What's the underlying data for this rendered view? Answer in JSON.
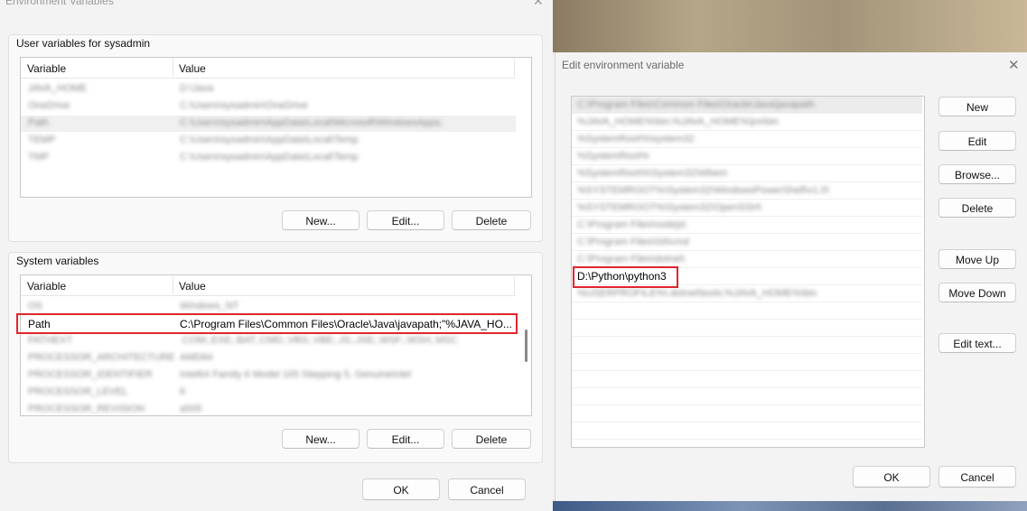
{
  "env_window": {
    "title": "Environment Variables",
    "close_glyph": "✕",
    "user_group": {
      "label": "User variables for sysadmin",
      "columns": [
        "Variable",
        "Value"
      ],
      "rows": [
        {
          "variable": "JAVA_HOME",
          "value": "D:\\Java"
        },
        {
          "variable": "OneDrive",
          "value": "C:\\Users\\sysadmin\\OneDrive"
        },
        {
          "variable": "Path",
          "value": "C:\\Users\\sysadmin\\AppData\\Local\\Microsoft\\WindowsApps;"
        },
        {
          "variable": "TEMP",
          "value": "C:\\Users\\sysadmin\\AppData\\Local\\Temp"
        },
        {
          "variable": "TMP",
          "value": "C:\\Users\\sysadmin\\AppData\\Local\\Temp"
        }
      ],
      "buttons": {
        "new": "New...",
        "edit": "Edit...",
        "delete": "Delete"
      }
    },
    "system_group": {
      "label": "System variables",
      "columns": [
        "Variable",
        "Value"
      ],
      "rows": [
        {
          "variable": "OS",
          "value": "Windows_NT"
        },
        {
          "variable": "Path",
          "value": "C:\\Program Files\\Common Files\\Oracle\\Java\\javapath;\"%JAVA_HO..."
        },
        {
          "variable": "PATHEXT",
          "value": ".COM;.EXE;.BAT;.CMD;.VBS;.VBE;.JS;.JSE;.WSF;.WSH;.MSC"
        },
        {
          "variable": "PROCESSOR_ARCHITECTURE",
          "value": "AMD64"
        },
        {
          "variable": "PROCESSOR_IDENTIFIER",
          "value": "Intel64 Family 6 Model 165 Stepping 5, GenuineIntel"
        },
        {
          "variable": "PROCESSOR_LEVEL",
          "value": "6"
        },
        {
          "variable": "PROCESSOR_REVISION",
          "value": "a505"
        }
      ],
      "buttons": {
        "new": "New...",
        "edit": "Edit...",
        "delete": "Delete"
      }
    },
    "ok": "OK",
    "cancel": "Cancel"
  },
  "edit_window": {
    "title": "Edit environment variable",
    "close_glyph": "✕",
    "path_items": [
      "C:\\Program Files\\Common Files\\Oracle\\Java\\javapath",
      "%JAVA_HOME%\\bin;%JAVA_HOME%\\jre\\bin",
      "%SystemRoot%\\system32",
      "%SystemRoot%",
      "%SystemRoot%\\System32\\Wbem",
      "%SYSTEMROOT%\\System32\\WindowsPowerShell\\v1.0\\",
      "%SYSTEMROOT%\\System32\\OpenSSH\\",
      "C:\\Program Files\\nodejs\\",
      "C:\\Program Files\\Git\\cmd",
      "C:\\Program Files\\dotnet\\",
      "D:\\Python\\python3",
      "%USERPROFILE%\\.dotnet\\tools;%JAVA_HOME%\\bin"
    ],
    "buttons": {
      "new": "New",
      "edit": "Edit",
      "browse": "Browse...",
      "delete": "Delete",
      "move_up": "Move Up",
      "move_down": "Move Down",
      "edit_text": "Edit text..."
    },
    "ok": "OK",
    "cancel": "Cancel"
  },
  "colors": {
    "highlight": "#e0262f"
  }
}
